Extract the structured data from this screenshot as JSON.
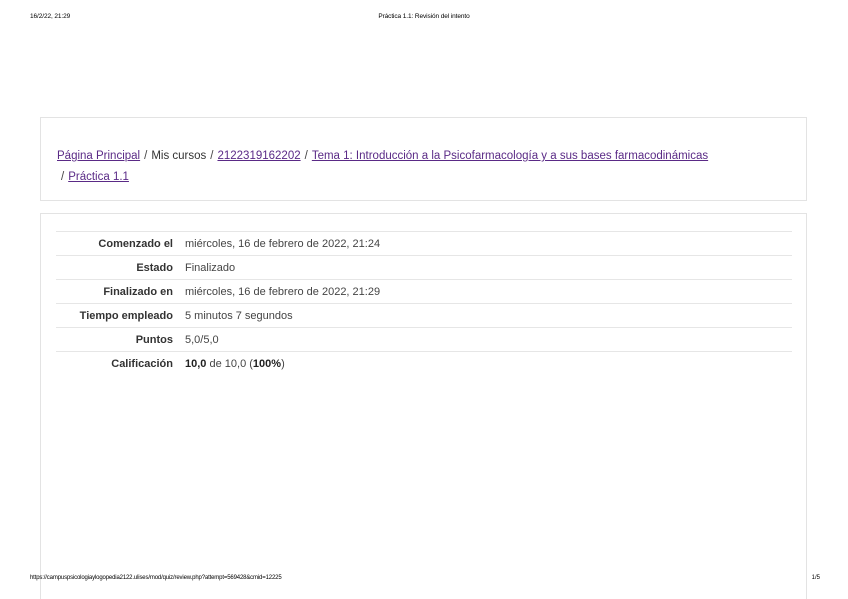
{
  "print_header": {
    "datetime": "16/2/22, 21:29",
    "title": "Práctica 1.1: Revisión del intento"
  },
  "print_footer": {
    "url": "https://campuspsicologiaylogopedia2122.ulises/mod/quiz/review.php?attempt=569428&cmid=12225",
    "page": "1/5"
  },
  "breadcrumb": {
    "home": "Página Principal",
    "my_courses": "Mis cursos",
    "course": "2122319162202",
    "topic": "Tema 1: Introducción a la Psicofarmacología y a sus bases farmacodinámicas",
    "activity": "Práctica 1.1",
    "separator": "/"
  },
  "summary": {
    "started_label": "Comenzado el",
    "started_value": "miércoles, 16 de febrero de 2022, 21:24",
    "state_label": "Estado",
    "state_value": "Finalizado",
    "finished_label": "Finalizado en",
    "finished_value": "miércoles, 16 de febrero de 2022, 21:29",
    "time_label": "Tiempo empleado",
    "time_value": "5 minutos 7 segundos",
    "points_label": "Puntos",
    "points_value": "5,0/5,0",
    "grade_label": "Calificación",
    "grade_value": "10,0",
    "grade_of": "de 10,0",
    "grade_percent": "100%"
  }
}
